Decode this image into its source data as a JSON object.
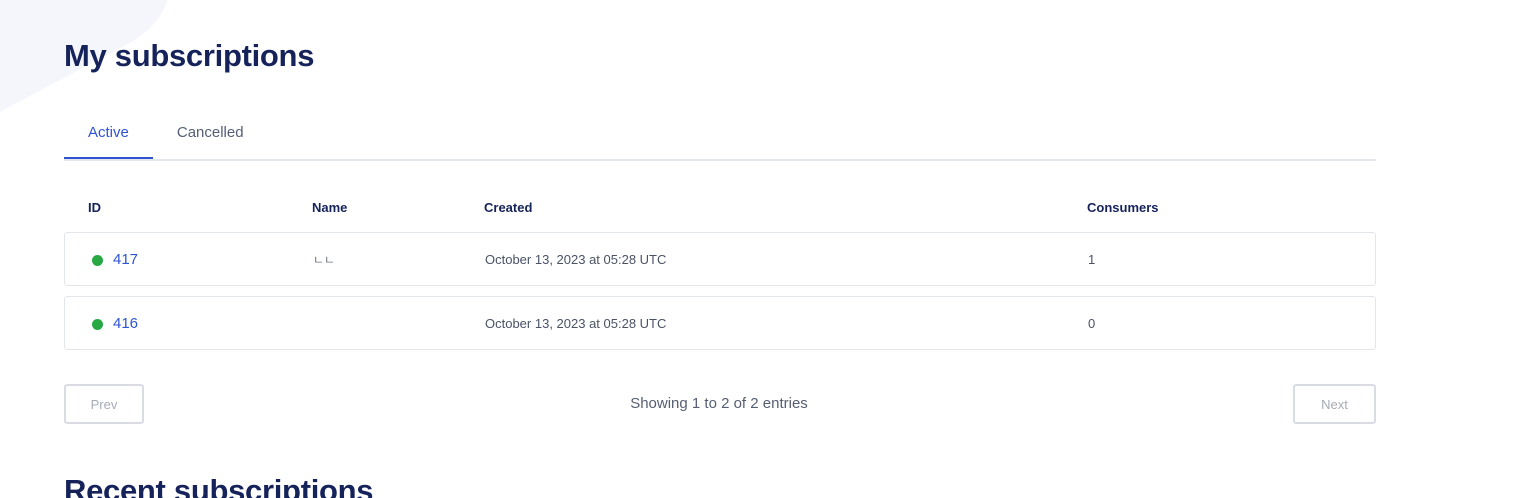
{
  "page_title": "My subscriptions",
  "tabs": [
    {
      "label": "Active",
      "active": true
    },
    {
      "label": "Cancelled",
      "active": false
    }
  ],
  "table": {
    "columns": [
      "ID",
      "Name",
      "Created",
      "Consumers"
    ],
    "rows": [
      {
        "id": "417",
        "name": "ㄴㄴ",
        "created": "October 13, 2023 at 05:28 UTC",
        "consumers": "1",
        "status": "active"
      },
      {
        "id": "416",
        "name": "",
        "created": "October 13, 2023 at 05:28 UTC",
        "consumers": "0",
        "status": "active"
      }
    ]
  },
  "pagination": {
    "prev_label": "Prev",
    "next_label": "Next",
    "info": "Showing 1 to 2 of 2 entries"
  },
  "recent_section_title": "Recent subscriptions",
  "colors": {
    "accent": "#2f54d1",
    "status_active": "#28a745",
    "title": "#16235a"
  }
}
